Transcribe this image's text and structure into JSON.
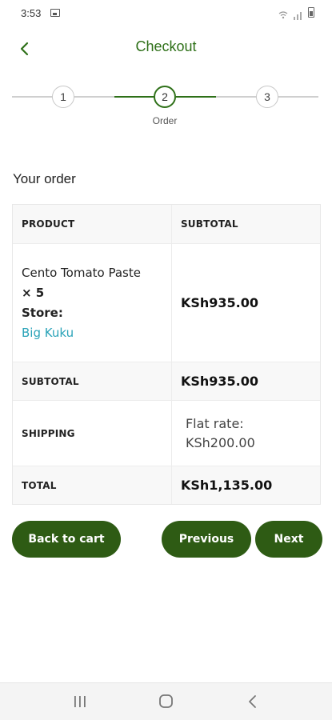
{
  "status_bar": {
    "time": "3:53"
  },
  "header": {
    "title": "Checkout"
  },
  "stepper": {
    "steps": [
      {
        "number": "1"
      },
      {
        "number": "2",
        "label": "Order"
      },
      {
        "number": "3"
      }
    ],
    "current_step": 2
  },
  "order": {
    "section_title": "Your order",
    "headers": {
      "product": "PRODUCT",
      "subtotal": "SUBTOTAL"
    },
    "item": {
      "name": "Cento Tomato Paste",
      "quantity": "× 5",
      "store_label": "Store:",
      "store_name": "Big Kuku",
      "amount": "KSh935.00"
    },
    "subtotal_row": {
      "label": "SUBTOTAL",
      "value": "KSh935.00"
    },
    "shipping_row": {
      "label": "SHIPPING",
      "method": "Flat rate:",
      "value": "KSh200.00"
    },
    "total_row": {
      "label": "TOTAL",
      "value": "KSh1,135.00"
    }
  },
  "actions": {
    "back_to_cart": "Back to cart",
    "previous": "Previous",
    "next": "Next"
  },
  "colors": {
    "accent_green": "#2e7018",
    "button_green": "#2e5b14",
    "link_teal": "#2aa3b8"
  },
  "icons": {
    "back": "chevron-left-icon",
    "nav_recents": "recents-icon",
    "nav_home": "home-icon",
    "nav_back": "back-icon"
  }
}
